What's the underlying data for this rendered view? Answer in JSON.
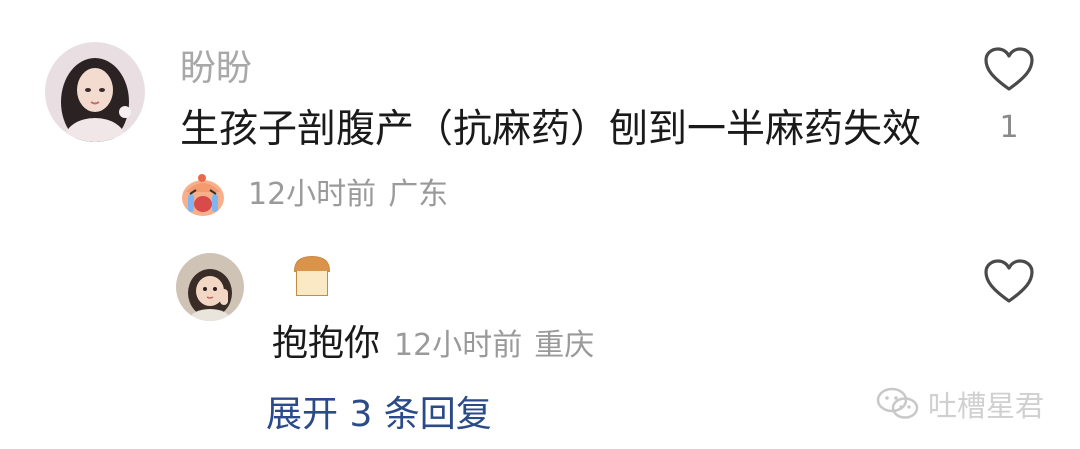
{
  "comment": {
    "username": "盼盼",
    "text": "生孩子剖腹产（抗麻药）刨到一半麻药失效",
    "time": "12小时前",
    "location": "广东",
    "like_count": "1",
    "badge_icon": "crying-face-icon"
  },
  "reply": {
    "badge_icon": "bread-icon",
    "text": "抱抱你",
    "time": "12小时前",
    "location": "重庆"
  },
  "expand_label": "展开 3 条回复",
  "watermark": "吐槽星君"
}
